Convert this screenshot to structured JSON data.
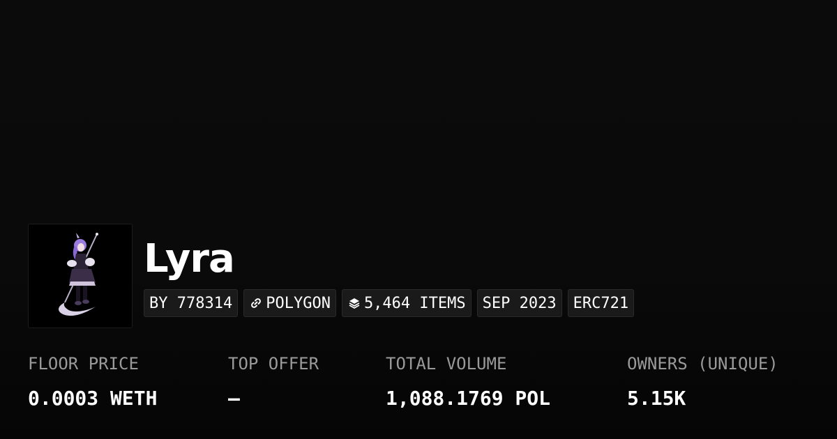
{
  "collection": {
    "name": "Lyra",
    "avatar_icon": "anime-character-with-scythe"
  },
  "badges": [
    {
      "label": "BY 778314",
      "icon": ""
    },
    {
      "label": "POLYGON",
      "icon": "link-icon"
    },
    {
      "label": "5,464 ITEMS",
      "icon": "layers-icon"
    },
    {
      "label": "SEP 2023",
      "icon": ""
    },
    {
      "label": "ERC721",
      "icon": ""
    }
  ],
  "stats": [
    {
      "label": "FLOOR PRICE",
      "value": "0.0003 WETH"
    },
    {
      "label": "TOP OFFER",
      "value": "—"
    },
    {
      "label": "TOTAL VOLUME",
      "value": "1,088.1769 POL"
    },
    {
      "label": "OWNERS (UNIQUE)",
      "value": "5.15K"
    }
  ],
  "colors": {
    "background": "#0b0b0b",
    "badge_bg": "#1a1a1a",
    "label_gray": "#9a9a9a",
    "text": "#ffffff"
  }
}
